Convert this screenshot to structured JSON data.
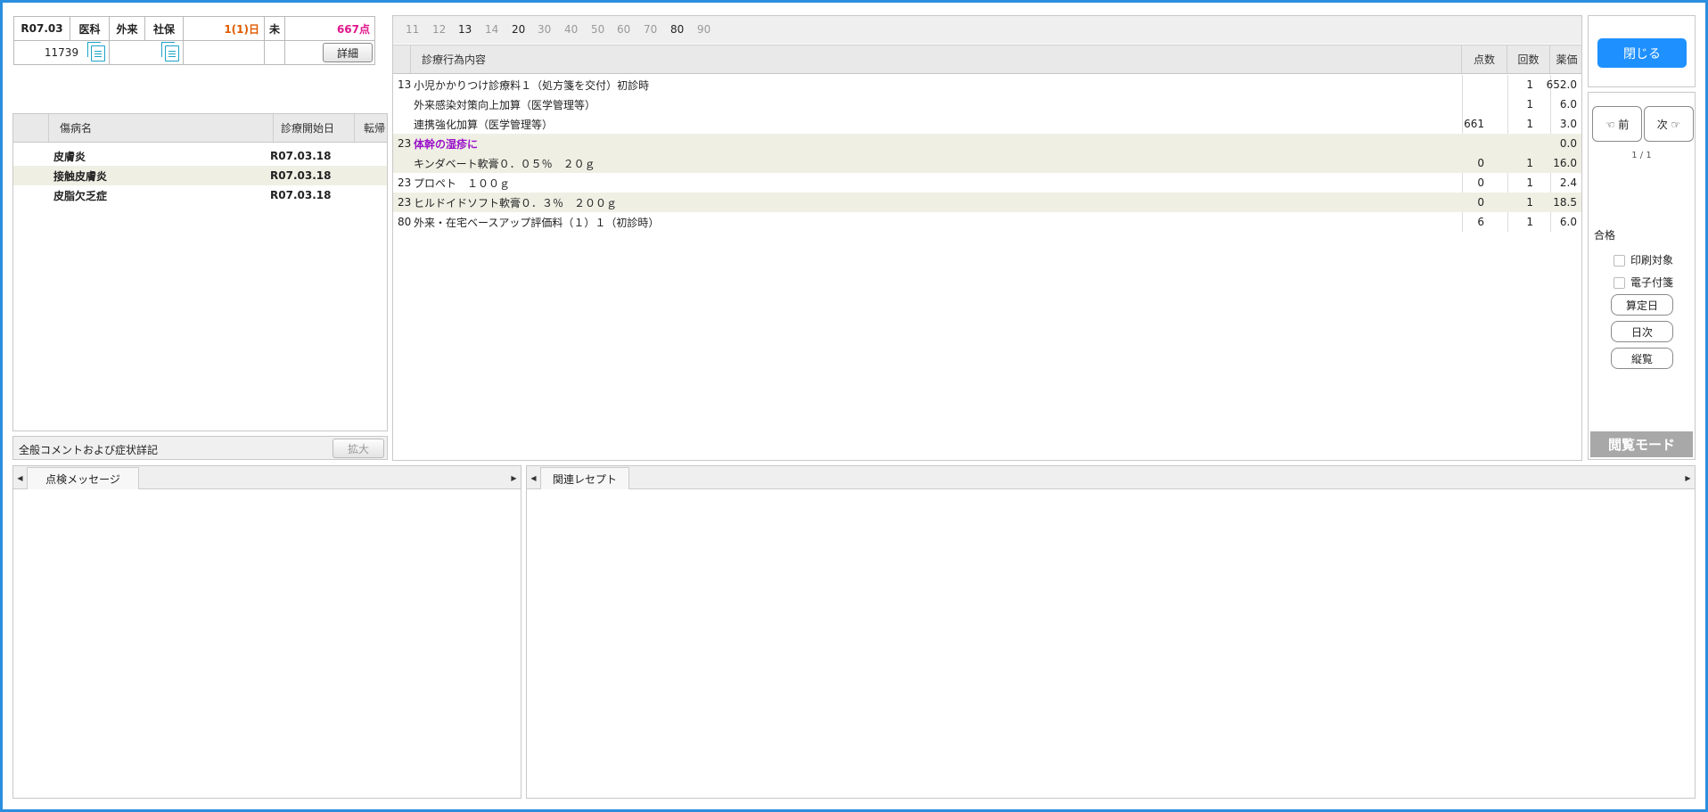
{
  "header": {
    "date": "R07.03",
    "dept": "医科",
    "type": "外来",
    "insurance": "社保",
    "days": "1(1)日",
    "status": "未",
    "points": "667点",
    "patient_id": "11739",
    "detail_button": "詳細"
  },
  "disease_table": {
    "headers": [
      "傷病名",
      "診療開始日",
      "転帰"
    ],
    "rows": [
      {
        "name": "皮膚炎",
        "start": "R07.03.18",
        "outcome": ""
      },
      {
        "name": "接触皮膚炎",
        "start": "R07.03.18",
        "outcome": ""
      },
      {
        "name": "皮脂欠乏症",
        "start": "R07.03.18",
        "outcome": ""
      }
    ]
  },
  "comment_bar": {
    "label": "全般コメントおよび症状詳記",
    "expand_button": "拡大"
  },
  "code_tabs": [
    {
      "label": "11",
      "active": false
    },
    {
      "label": "12",
      "active": false
    },
    {
      "label": "13",
      "active": true
    },
    {
      "label": "14",
      "active": false
    },
    {
      "label": "20",
      "active": true
    },
    {
      "label": "30",
      "active": false
    },
    {
      "label": "40",
      "active": false
    },
    {
      "label": "50",
      "active": false
    },
    {
      "label": "60",
      "active": false
    },
    {
      "label": "70",
      "active": false
    },
    {
      "label": "80",
      "active": true
    },
    {
      "label": "90",
      "active": false
    }
  ],
  "treatment_table": {
    "headers": {
      "content": "診療行為内容",
      "points": "点数",
      "count": "回数",
      "price": "薬価"
    },
    "rows": [
      {
        "code": "13",
        "content": "小児かかりつけ診療料１（処方箋を交付）初診時",
        "points": "",
        "count": "1",
        "price": "652.0",
        "alt": false,
        "highlight": false
      },
      {
        "code": "",
        "content": "外来感染対策向上加算（医学管理等）",
        "points": "",
        "count": "1",
        "price": "6.0",
        "alt": false,
        "highlight": false
      },
      {
        "code": "",
        "content": "連携強化加算（医学管理等）",
        "points": "661",
        "count": "1",
        "price": "3.0",
        "alt": false,
        "highlight": false
      },
      {
        "code": "23",
        "content": "体幹の湿疹に",
        "points": "",
        "count": "",
        "price": "0.0",
        "alt": true,
        "highlight": true
      },
      {
        "code": "",
        "content": "キンダベート軟膏０．０５％　２０ｇ",
        "points": "0",
        "count": "1",
        "price": "16.0",
        "alt": true,
        "highlight": false
      },
      {
        "code": "23",
        "content": "プロペト　１００ｇ",
        "points": "0",
        "count": "1",
        "price": "2.4",
        "alt": false,
        "highlight": false
      },
      {
        "code": "23",
        "content": "ヒルドイドソフト軟膏０．３％　２００ｇ",
        "points": "0",
        "count": "1",
        "price": "18.5",
        "alt": true,
        "highlight": false
      },
      {
        "code": "80",
        "content": "外来・在宅ベースアップ評価料（１）１（初診時）",
        "points": "6",
        "count": "1",
        "price": "6.0",
        "alt": false,
        "highlight": false
      }
    ]
  },
  "side": {
    "close_button": "閉じる",
    "prev_button": "前",
    "next_button": "次",
    "page_indicator": "1 / 1",
    "result_label": "合格",
    "print_target": "印刷対象",
    "e_tag": "電子付箋",
    "calc_day_button": "算定日",
    "daily_button": "日次",
    "vertical_button": "縦覧",
    "mode_label": "閲覧モード"
  },
  "bottom": {
    "left_tab": "点検メッセージ",
    "right_tab": "関連レセプト"
  },
  "colors": {
    "accent": "#2b8ede",
    "close_button": "#1e90ff",
    "days_text": "#e05a00",
    "points_text": "#e0168c",
    "highlight_text": "#9b12c9",
    "alt_row": "#efefe4"
  }
}
